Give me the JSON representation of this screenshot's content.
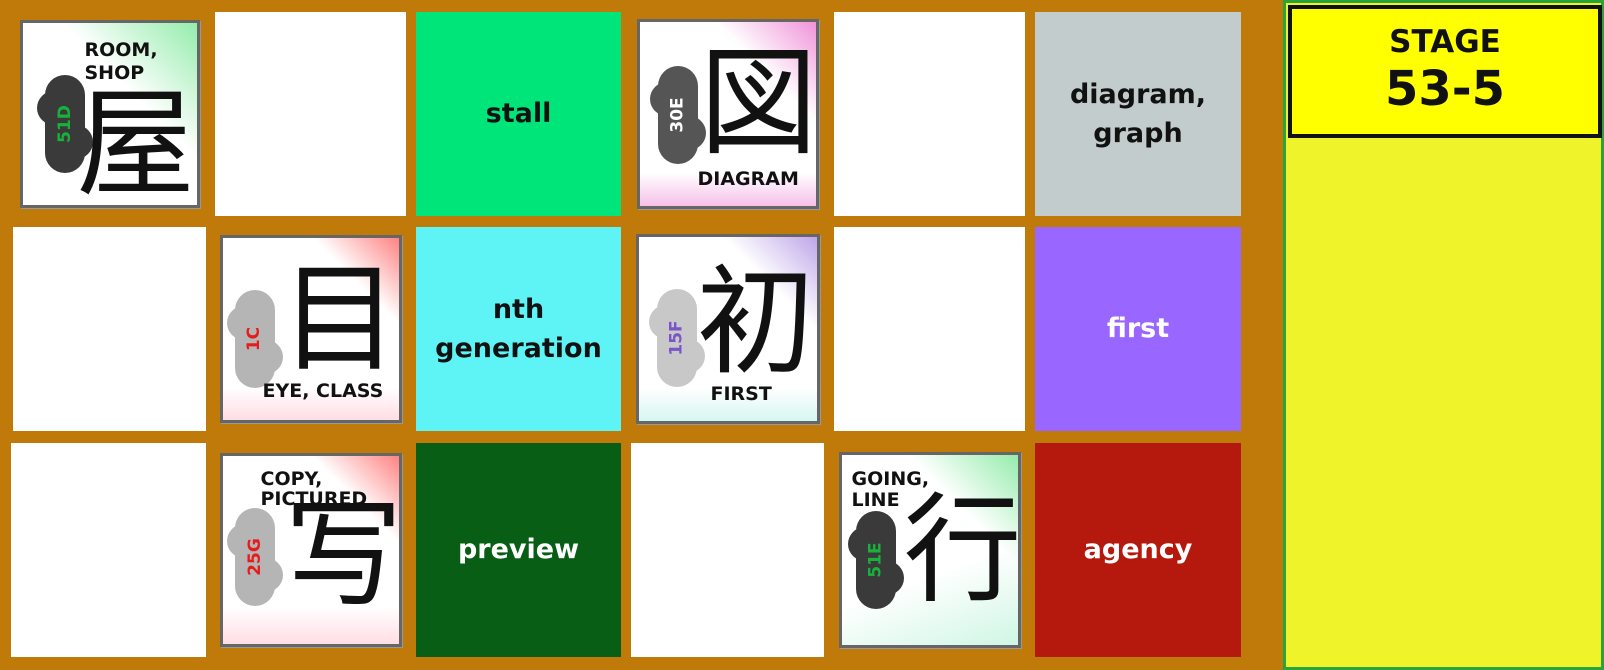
{
  "stage": {
    "label": "STAGE",
    "number": "53-5"
  },
  "cards": {
    "r1c1": {
      "kanji": "屋",
      "meaning": "ROOM,\nSHOP",
      "code": "51D",
      "code_color": "#17b23a",
      "cloud_color": "#3a3a3a",
      "accent": "#3ddc68"
    },
    "r1c4": {
      "kanji": "図",
      "meaning": "DIAGRAM",
      "code": "30E",
      "code_color": "#ffffff",
      "cloud_color": "#555555",
      "accent": "#e64bc0"
    },
    "r2c2": {
      "kanji": "目",
      "meaning": "EYE, CLASS",
      "code": "1C",
      "code_color": "#e61c1c",
      "cloud_color": "#b5b5b5",
      "accent": "#ff3030"
    },
    "r2c4": {
      "kanji": "初",
      "meaning": "FIRST",
      "code": "15F",
      "code_color": "#7a55c8",
      "cloud_color": "#c8c8c8",
      "accent": "#8a5cd6"
    },
    "r3c2": {
      "kanji": "写",
      "meaning": "COPY,\nPICTURED",
      "code": "25G",
      "code_color": "#e61c1c",
      "cloud_color": "#b5b5b5",
      "accent": "#ff3030"
    },
    "r3c5": {
      "kanji": "行",
      "meaning": "GOING,\nLINE",
      "code": "51E",
      "code_color": "#17b23a",
      "cloud_color": "#3a3a3a",
      "accent": "#3ddc68"
    }
  },
  "words": {
    "stall": {
      "text": "stall",
      "bg": "#00e57a",
      "fg": "#111111"
    },
    "diagram_graph": {
      "text": "diagram,\ngraph",
      "bg": "#c3cccc",
      "fg": "#111111"
    },
    "nth_generation": {
      "text": "nth\ngeneration",
      "bg": "#5ef4f6",
      "fg": "#111111"
    },
    "first": {
      "text": "first",
      "bg": "#9966ff",
      "fg": "#ffffff"
    },
    "preview": {
      "text": "preview",
      "bg": "#085e14",
      "fg": "#ffffff"
    },
    "agency": {
      "text": "agency",
      "bg": "#b5190e",
      "fg": "#ffffff"
    }
  }
}
